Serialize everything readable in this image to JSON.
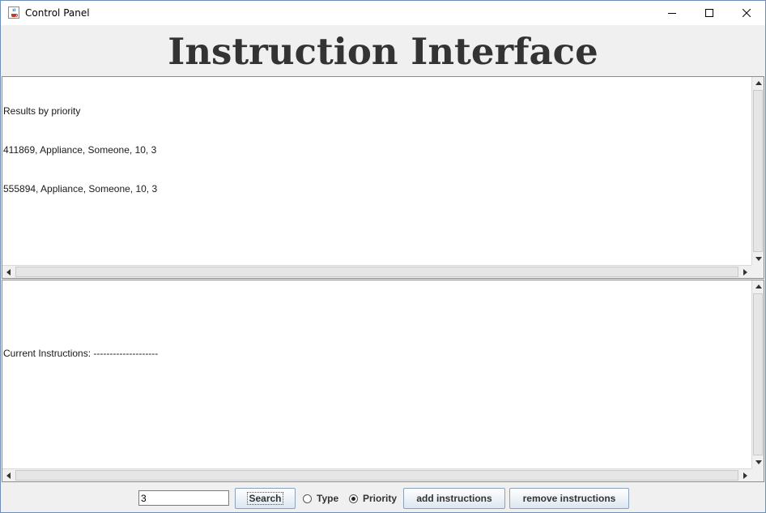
{
  "window": {
    "title": "Control Panel"
  },
  "heading": "Instruction Interface",
  "results_pane": {
    "lines": [
      "Results by priority",
      "411869, Appliance, Someone, 10, 3",
      "555894, Appliance, Someone, 10, 3"
    ]
  },
  "instructions_pane": {
    "lines": [
      "",
      "Current Instructions: --------------------"
    ]
  },
  "controls": {
    "search_value": "3",
    "search_label": "Search",
    "radio_type_label": "Type",
    "radio_priority_label": "Priority",
    "selected_radio": "Priority",
    "add_label": "add instructions",
    "remove_label": "remove instructions"
  },
  "icons": {
    "app": "java-cup-icon",
    "minimize": "minimize-icon",
    "maximize": "maximize-icon",
    "close": "close-icon"
  }
}
